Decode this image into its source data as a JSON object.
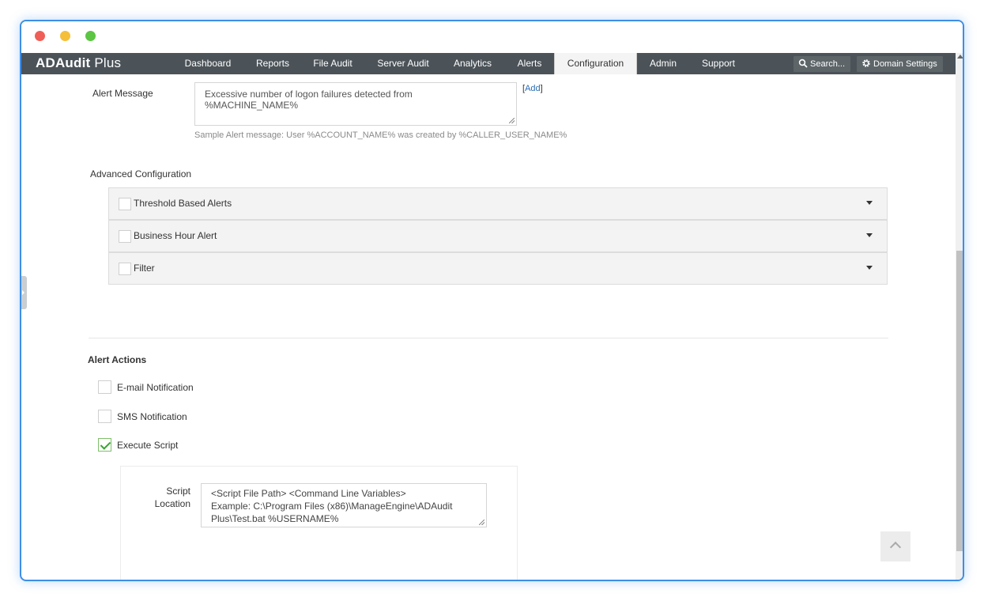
{
  "app": {
    "name": "ADAudit",
    "name_suffix": " Plus"
  },
  "nav": {
    "items": [
      {
        "label": "Dashboard"
      },
      {
        "label": "Reports"
      },
      {
        "label": "File Audit"
      },
      {
        "label": "Server Audit"
      },
      {
        "label": "Analytics"
      },
      {
        "label": "Alerts"
      },
      {
        "label": "Configuration",
        "active": true
      },
      {
        "label": "Admin"
      },
      {
        "label": "Support"
      }
    ],
    "search_label": "Search...",
    "domain_settings_label": "Domain Settings"
  },
  "alert_message": {
    "label": "Alert Message",
    "value": "Excessive number of logon failures detected from %MACHINE_NAME%",
    "add_open": "[",
    "add_label": "Add",
    "add_close": "]",
    "sample": "Sample Alert message: User %ACCOUNT_NAME% was created by %CALLER_USER_NAME%"
  },
  "advanced": {
    "heading": "Advanced Configuration",
    "items": [
      {
        "label": "Threshold Based Alerts",
        "checked": false
      },
      {
        "label": "Business Hour Alert",
        "checked": false
      },
      {
        "label": "Filter",
        "checked": false
      }
    ]
  },
  "alert_actions": {
    "heading": "Alert Actions",
    "items": [
      {
        "label": "E-mail Notification",
        "checked": false
      },
      {
        "label": "SMS Notification",
        "checked": false
      },
      {
        "label": "Execute Script",
        "checked": true
      }
    ]
  },
  "script": {
    "label_line1": "Script",
    "label_line2": "Location",
    "placeholder_line1": "<Script File Path> <Command Line Variables>",
    "placeholder_line2": "Example: C:\\Program Files (x86)\\ManageEngine\\ADAudit",
    "placeholder_line3": "Plus\\Test.bat %USERNAME%"
  },
  "colors": {
    "navbar": "#4b5359",
    "window_border": "#3d8ee6",
    "check": "#3aa335",
    "link": "#2a6db5"
  }
}
